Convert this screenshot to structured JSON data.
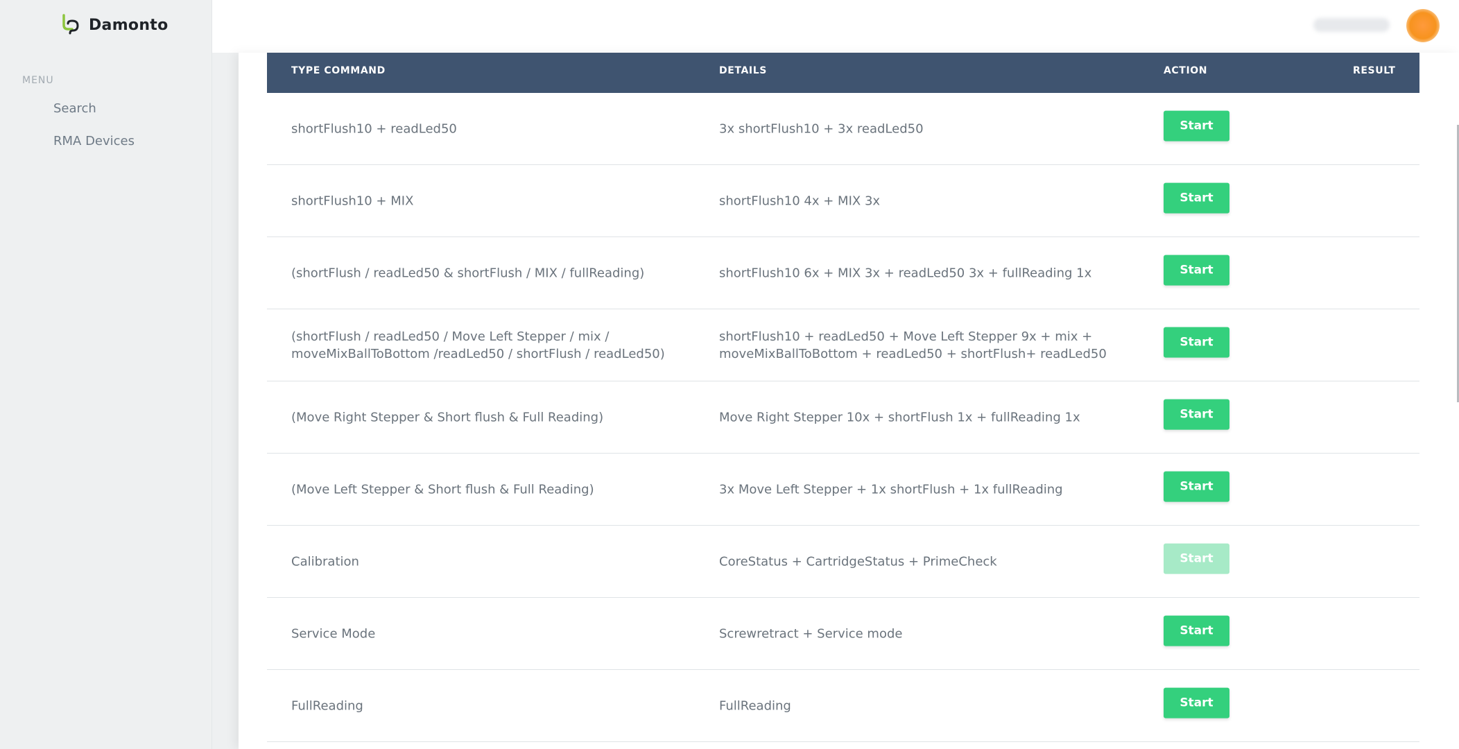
{
  "brand": {
    "name": "Damonto"
  },
  "sidebar": {
    "menu_heading": "MENU",
    "items": [
      {
        "label": "Search"
      },
      {
        "label": "RMA Devices"
      }
    ]
  },
  "table": {
    "headers": {
      "type_command": "TYPE COMMAND",
      "details": "DETAILS",
      "action": "ACTION",
      "result": "RESULT"
    },
    "rows": [
      {
        "type": "shortFlush10 + readLed50",
        "details": "3x shortFlush10 + 3x readLed50",
        "action": "Start",
        "enabled": true
      },
      {
        "type": "shortFlush10 + MIX",
        "details": "shortFlush10 4x + MIX 3x",
        "action": "Start",
        "enabled": true
      },
      {
        "type": "(shortFlush / readLed50 & shortFlush / MIX / fullReading)",
        "details": "shortFlush10 6x + MIX 3x + readLed50 3x + fullReading 1x",
        "action": "Start",
        "enabled": true
      },
      {
        "type": "(shortFlush / readLed50 / Move Left Stepper / mix / moveMixBallToBottom /readLed50 / shortFlush / readLed50)",
        "details": "shortFlush10 + readLed50 + Move Left Stepper 9x + mix + moveMixBallToBottom + readLed50 + shortFlush+ readLed50",
        "action": "Start",
        "enabled": true
      },
      {
        "type": "(Move Right Stepper & Short flush & Full Reading)",
        "details": "Move Right Stepper 10x + shortFlush 1x + fullReading 1x",
        "action": "Start",
        "enabled": true
      },
      {
        "type": "(Move Left Stepper & Short flush & Full Reading)",
        "details": "3x Move Left Stepper + 1x shortFlush + 1x fullReading",
        "action": "Start",
        "enabled": true
      },
      {
        "type": "Calibration",
        "details": "CoreStatus + CartridgeStatus + PrimeCheck",
        "action": "Start",
        "enabled": false
      },
      {
        "type": "Service Mode",
        "details": "Screwretract + Service mode",
        "action": "Start",
        "enabled": true
      },
      {
        "type": "FullReading",
        "details": "FullReading",
        "action": "Start",
        "enabled": true
      }
    ]
  },
  "colors": {
    "table_header": "#3f5470",
    "start_button": "#34d07d",
    "start_button_disabled": "#a7eac7",
    "avatar": "#f7931e",
    "logo_green": "#8dc63f"
  }
}
